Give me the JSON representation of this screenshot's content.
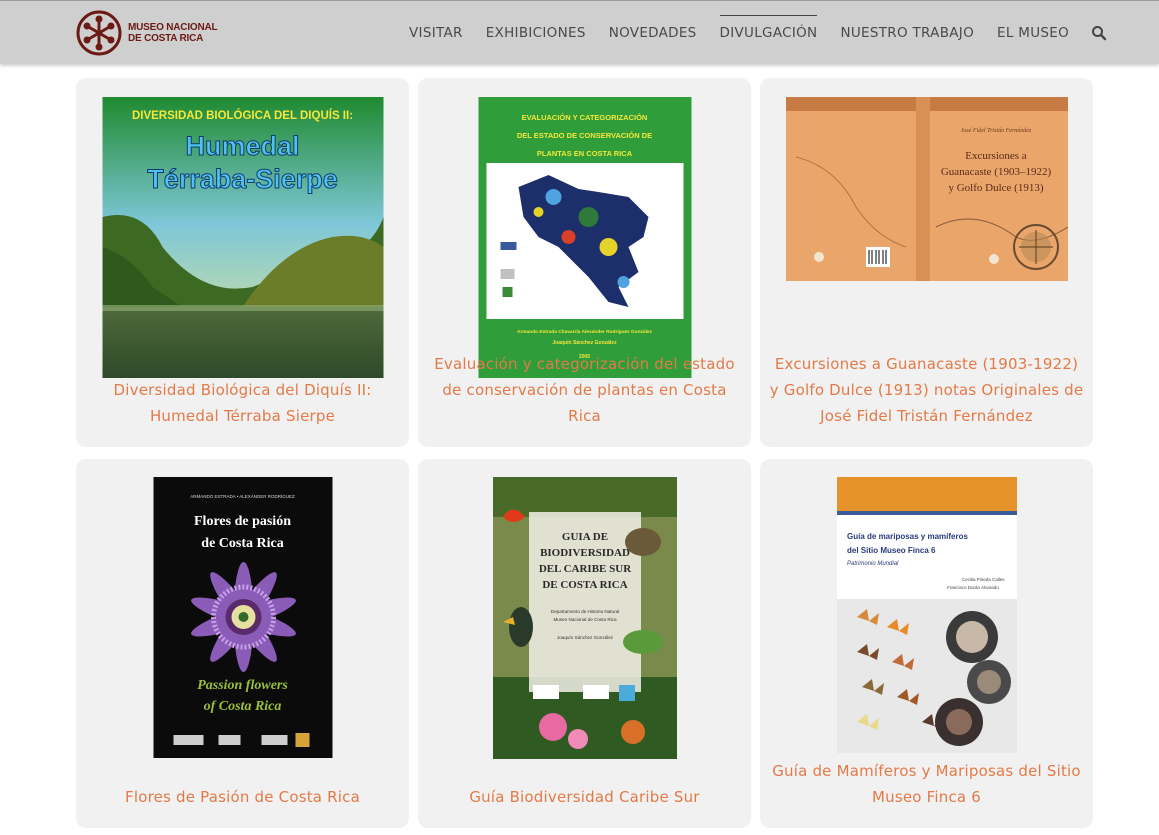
{
  "brand": {
    "line1": "MUSEO NACIONAL",
    "line2": "DE COSTA RICA",
    "color": "#6b1a14"
  },
  "nav": {
    "items": [
      {
        "label": "VISITAR",
        "active": false
      },
      {
        "label": "EXHIBICIONES",
        "active": false
      },
      {
        "label": "NOVEDADES",
        "active": false
      },
      {
        "label": "DIVULGACIÓN",
        "active": true
      },
      {
        "label": "NUESTRO TRABAJO",
        "active": false
      },
      {
        "label": "EL MUSEO",
        "active": false
      }
    ],
    "search_icon": "search-icon"
  },
  "accent_color": "#e37a48",
  "cards": [
    {
      "title": "Diversidad Biológica del Diquís II: Humedal Térraba Sierpe",
      "cover": {
        "top_text": "DIVERSIDAD BIOLÓGICA DEL DIQUÍS II:",
        "main_line1": "Humedal",
        "main_line2": "Térraba-Sierpe"
      }
    },
    {
      "title": "Evaluación y categorización del estado de conservación de plantas en Costa Rica",
      "cover": {
        "line1": "EVALUACIÓN Y CATEGORIZACIÓN",
        "line2": "DEL ESTADO DE CONSERVACIÓN DE",
        "line3": "PLANTAS EN COSTA RICA",
        "authors1": "Armando Estrada Chavarría    Alexánder Rodríguez González",
        "authors2": "Joaquín Sánchez González",
        "year": "2005"
      }
    },
    {
      "title": "Excursiones a Guanacaste (1903-1922) y Golfo Dulce (1913) notas Originales de José Fidel Tristán Fernández",
      "cover": {
        "author": "José Fidel Tristán Fernández",
        "line1": "Excursiones a",
        "line2": "Guanacaste (1903–1922)",
        "line3": "y Golfo Dulce (1913)"
      }
    },
    {
      "title": "Flores de Pasión de Costa Rica",
      "cover": {
        "authors": "ARMANDO ESTRADA • ALEXÁNDER RODRÍGUEZ",
        "line1": "Flores de pasión",
        "line2": "de Costa Rica",
        "sub1": "Passion flowers",
        "sub2": "of Costa Rica"
      }
    },
    {
      "title": "Guía Biodiversidad Caribe Sur",
      "cover": {
        "line1": "GUIA DE",
        "line2": "BIODIVERSIDAD",
        "line3": "DEL CARIBE SUR",
        "line4": "DE COSTA RICA",
        "dept": "Departamento de Historia Natural",
        "museum": "Museo Nacional de Costa Rica",
        "editor": "Joaquín Sánchez González"
      }
    },
    {
      "title": "Guía de Mamíferos y Mariposas del Sitio Museo Finca 6",
      "cover": {
        "line1": "Guía de mariposas y mamíferos",
        "line2": "del Sitio Museo Finca 6",
        "line3": "Patrimonio Mundial",
        "author1": "Cecilia Pineda Calles",
        "author2": "Francisco Durán Alvarado"
      }
    }
  ]
}
